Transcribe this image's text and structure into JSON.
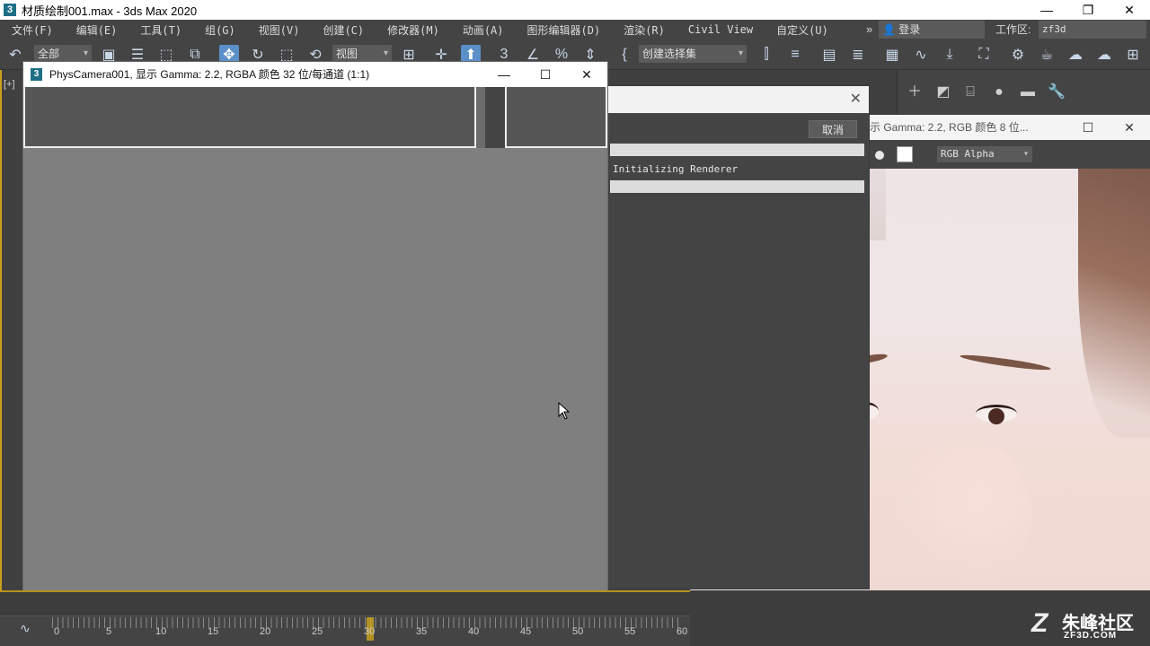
{
  "window": {
    "title": "材质绘制001.max - 3ds Max 2020",
    "app_icon": "3",
    "buttons": {
      "minimize": "—",
      "restore": "❐",
      "close": "✕"
    }
  },
  "menu": {
    "items": [
      "文件(F)",
      "编辑(E)",
      "工具(T)",
      "组(G)",
      "视图(V)",
      "创建(C)",
      "修改器(M)",
      "动画(A)",
      "图形编辑器(D)",
      "渲染(R)",
      "Civil View",
      "自定义(U)"
    ],
    "overflow": "»",
    "login": "登录",
    "workspace_label": "工作区:",
    "workspace_value": "zf3d"
  },
  "toolbar": {
    "selection_filter": "全部",
    "reference_coord": "视图",
    "named_selection": "创建选择集"
  },
  "viewport": {
    "label": "[+]"
  },
  "render_window": {
    "icon": "3",
    "title": "PhysCamera001, 显示 Gamma: 2.2, RGBA 颜色 32 位/每通道 (1:1)",
    "buttons": {
      "minimize": "—",
      "maximize": "☐",
      "close": "✕"
    }
  },
  "progress_dialog": {
    "close": "✕",
    "cancel_label": "取消",
    "status": "Initializing Renderer"
  },
  "photo_window": {
    "title": "示 Gamma: 2.2, RGB 颜色 8 位...",
    "buttons": {
      "maximize": "☐",
      "close": "✕"
    },
    "channel": "RGB Alpha"
  },
  "timeline": {
    "frame_labels": [
      "0",
      "5",
      "10",
      "15",
      "20",
      "25",
      "30",
      "35",
      "40",
      "45",
      "50",
      "55",
      "60"
    ],
    "current_frame": 30
  },
  "watermark": {
    "logo": "Z",
    "name": "朱峰社区",
    "url": "ZF3D.COM"
  },
  "colors": {
    "app_bg": "#444444",
    "accent_blue": "#5b8fc7",
    "timeline_gold": "#c8a020",
    "render_canvas": "#7f7f7f"
  }
}
